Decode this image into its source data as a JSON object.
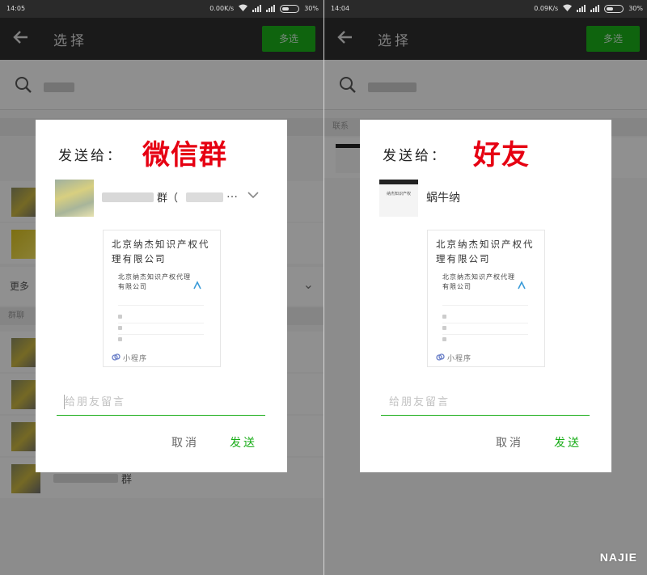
{
  "left": {
    "status": {
      "time": "14:05",
      "speed": "0.00K/s",
      "battery": "30%"
    },
    "appbar": {
      "title": "选择",
      "multi_select": "多选"
    },
    "list": {
      "more_label": "更多",
      "section_group": "群聊",
      "row_suffix": "群"
    },
    "dialog": {
      "send_to": "发送给：",
      "highlight": "微信群",
      "recipient_text": "群（",
      "ellipsis": "…",
      "card": {
        "title": "北京纳杰知识产权代理有限公司",
        "subtitle": "北京纳杰知识产权代理有限公司",
        "mini_program": "小程序"
      },
      "message_placeholder": "给朋友留言",
      "cancel": "取消",
      "send": "发送"
    }
  },
  "right": {
    "status": {
      "time": "14:04",
      "speed": "0.09K/s",
      "battery": "30%"
    },
    "appbar": {
      "title": "选择",
      "multi_select": "多选"
    },
    "list": {
      "section_contacts": "联系"
    },
    "dialog": {
      "send_to": "发送给：",
      "highlight": "好友",
      "recipient_avatar_text": "纳杰知识产权",
      "recipient_text": "蜗牛纳",
      "card": {
        "title": "北京纳杰知识产权代理有限公司",
        "subtitle": "北京纳杰知识产权代理有限公司",
        "mini_program": "小程序"
      },
      "message_placeholder": "给朋友留言",
      "cancel": "取消",
      "send": "发送"
    }
  },
  "brand": "NAJIE",
  "colors": {
    "accent_green": "#1aad19",
    "highlight_red": "#e60012",
    "appbar": "#2e2e2e"
  }
}
